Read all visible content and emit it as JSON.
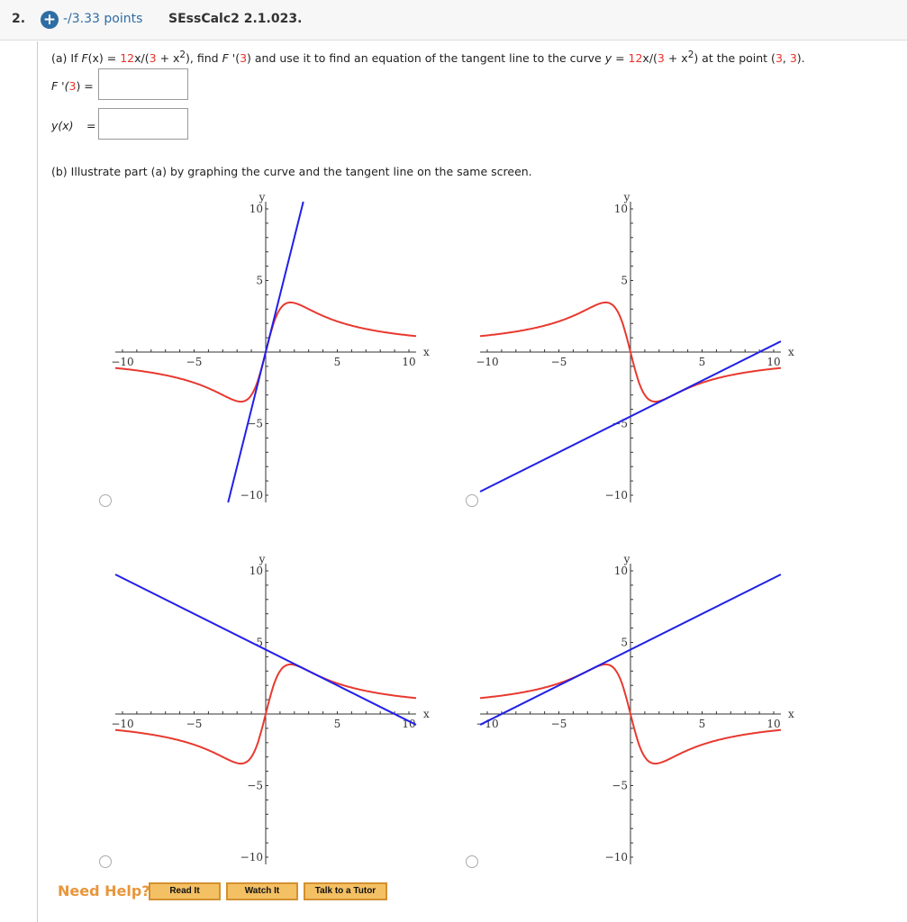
{
  "header": {
    "number": "2.",
    "points": "-/3.33 points",
    "code": "SEssCalc2 2.1.023."
  },
  "part_a": {
    "p1": "(a) If ",
    "Fx": "F",
    "x1": "(x) = ",
    "n12": "12",
    "x2": "x/(",
    "n3": "3",
    "x3": " + x",
    "sup2": "2",
    "x4": "),  find ",
    "F2": "F",
    "x5": " '(",
    "n3b": "3",
    "x6": ") and use it to find an equation of the tangent line to the curve ",
    "y": "y",
    "x7": " = ",
    "n12b": "12",
    "x8": "x/(",
    "n3c": "3",
    "x9": " + x",
    "sup2b": "2",
    "x10": ")  at the point (",
    "n3d": "3",
    "comma": ", ",
    "n3e": "3",
    "x11": ").",
    "fprime_label_pre": "F '(",
    "fprime_label_num": "3",
    "fprime_label_post": ") =",
    "fprime_value": "",
    "y_label": "y(x)",
    "y_eq": "=",
    "y_value": ""
  },
  "part_b": {
    "text": "(b) Illustrate part (a) by graphing the curve and the tangent line on the same screen."
  },
  "colors": {
    "curve": "#e8392f",
    "tangent": "#2020e8",
    "accent": "#2e6da4",
    "help": "#e8963c"
  },
  "chart_data": [
    {
      "type": "line",
      "xlabel": "x",
      "ylabel": "y",
      "xlim": [
        -10.5,
        10.5
      ],
      "ylim": [
        -10.5,
        10.5
      ],
      "xticks": [
        "-10",
        "-5",
        "5",
        "10"
      ],
      "yticks": [
        "10",
        "5",
        "-5",
        "-10"
      ],
      "curve": "12x/(3+x^2)",
      "curve_sign": 1,
      "tangent": {
        "slope": 4,
        "intercept": 0
      },
      "selected": false
    },
    {
      "type": "line",
      "xlabel": "x",
      "ylabel": "y",
      "xlim": [
        -10.5,
        10.5
      ],
      "ylim": [
        -10.5,
        10.5
      ],
      "xticks": [
        "-10",
        "-5",
        "5",
        "10"
      ],
      "yticks": [
        "10",
        "5",
        "-5",
        "-10"
      ],
      "curve": "-12x/(3+x^2)",
      "curve_sign": -1,
      "tangent": {
        "slope": 0.5,
        "intercept": -4.5
      },
      "selected": false
    },
    {
      "type": "line",
      "xlabel": "x",
      "ylabel": "y",
      "xlim": [
        -10.5,
        10.5
      ],
      "ylim": [
        -10.5,
        10.5
      ],
      "xticks": [
        "-10",
        "-5",
        "5",
        "10"
      ],
      "yticks": [
        "10",
        "5",
        "-5",
        "-10"
      ],
      "curve": "12x/(3+x^2)",
      "curve_sign": 1,
      "tangent": {
        "slope": -0.5,
        "intercept": 4.5
      },
      "selected": false
    },
    {
      "type": "line",
      "xlabel": "x",
      "ylabel": "y",
      "xlim": [
        -10.5,
        10.5
      ],
      "ylim": [
        -10.5,
        10.5
      ],
      "xticks": [
        "-10",
        "-5",
        "5",
        "10"
      ],
      "yticks": [
        "10",
        "5",
        "-5",
        "-10"
      ],
      "curve": "-12x/(3+x^2)",
      "curve_sign": -1,
      "tangent": {
        "slope": 0.5,
        "intercept": 4.5
      },
      "selected": false
    }
  ],
  "help": {
    "label": "Need Help?",
    "buttons": [
      "Read It",
      "Watch It",
      "Talk to a Tutor"
    ]
  }
}
